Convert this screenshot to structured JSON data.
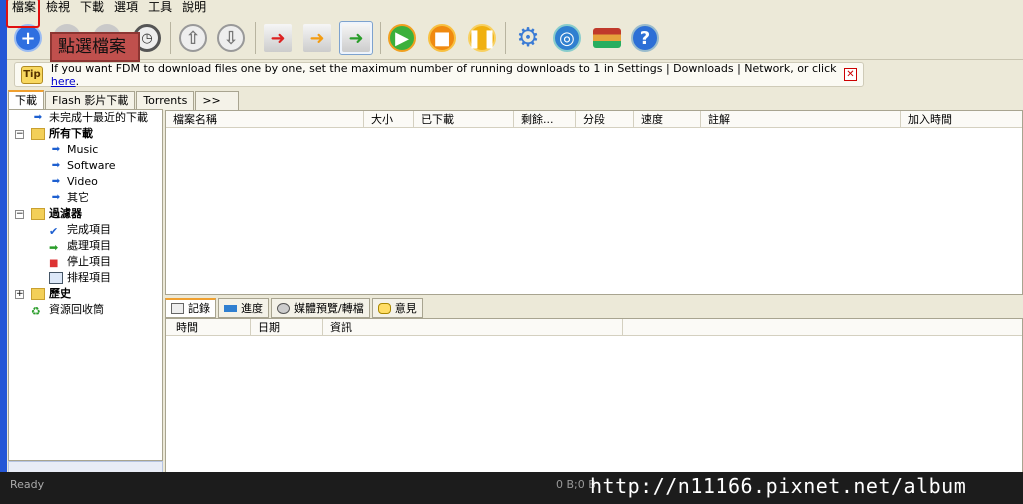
{
  "menu": [
    "檔案",
    "檢視",
    "下載",
    "選項",
    "工具",
    "說明"
  ],
  "callout": "點選檔案",
  "toolbar": {
    "buttons": [
      "add-download-icon",
      "start-icon",
      "stop-icon",
      "scheduler-clock-icon",
      "move-up-icon",
      "move-down-icon",
      "traffic-low-icon",
      "traffic-medium-icon",
      "traffic-high-icon",
      "start-all-icon",
      "stop-all-icon",
      "pause-all-icon",
      "settings-gear-icon",
      "community-globe-icon",
      "tutorial-books-icon",
      "help-question-icon"
    ]
  },
  "tip": {
    "badge": "Tip",
    "text": "If you want FDM to download files one by one, set the maximum number of running downloads to 1 in Settings | Downloads | Network, or click ",
    "link": "here",
    "suffix": "."
  },
  "tabs": [
    "下載",
    "Flash 影片下載",
    "Torrents",
    ">>"
  ],
  "tree": {
    "recent": "未完成十最近的下載",
    "all": "所有下載",
    "all_children": [
      "Music",
      "Software",
      "Video",
      "其它"
    ],
    "filters": "過濾器",
    "filter_children": [
      "完成項目",
      "處理項目",
      "停止項目",
      "排程項目"
    ],
    "history": "歷史",
    "recycle": "資源回收筒"
  },
  "columns": [
    "檔案名稱",
    "大小",
    "已下載",
    "剩餘...",
    "分段",
    "速度",
    "註解",
    "加入時間"
  ],
  "bottom_tabs": [
    "記錄",
    "進度",
    "媒體預覽/轉檔",
    "意見"
  ],
  "log_columns": [
    "時間",
    "日期",
    "資訊"
  ],
  "status": {
    "text": "Ready",
    "bytes": "0 B;0 B",
    "watermark": "http://n11166.pixnet.net/album"
  }
}
